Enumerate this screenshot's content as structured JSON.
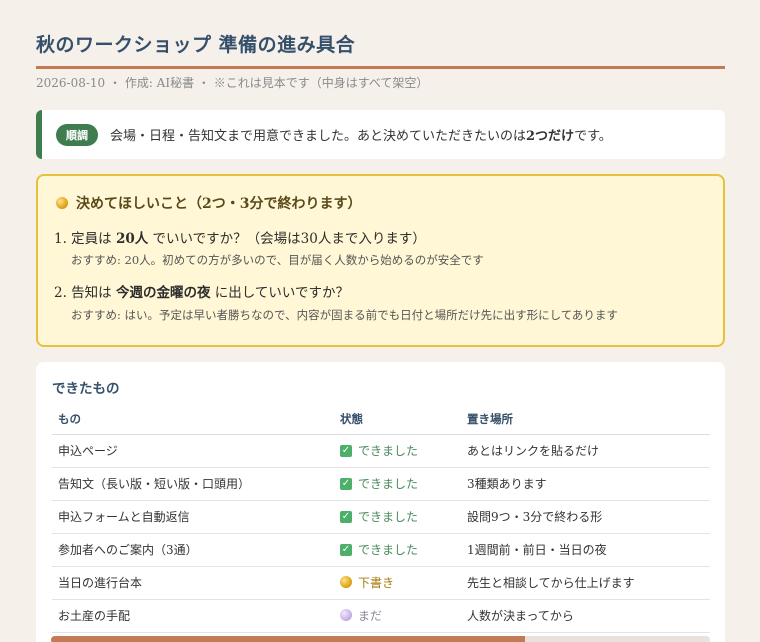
{
  "header": {
    "title": "秋のワークショップ 準備の進み具合",
    "meta": "2026-08-10 ・ 作成: AI秘書 ・ ※これは見本です（中身はすべて架空）"
  },
  "status": {
    "badge": "順調",
    "text_before": "会場・日程・告知文まで用意できました。あと決めていただきたいのは",
    "text_bold": "2つだけ",
    "text_after": "です。"
  },
  "decisions": {
    "heading": "決めてほしいこと（2つ・3分で終わります）",
    "items": [
      {
        "q_pre": "1. 定員は ",
        "q_bold": "20人",
        "q_post": " でいいですか？（会場は30人まで入ります）",
        "recommendation": "おすすめ: 20人。初めての方が多いので、目が届く人数から始めるのが安全です"
      },
      {
        "q_pre": "2. 告知は ",
        "q_bold": "今週の金曜の夜",
        "q_post": " に出していいですか？",
        "recommendation": "おすすめ: はい。予定は早い者勝ちなので、内容が固まる前でも日付と場所だけ先に出す形にしてあります"
      }
    ]
  },
  "done": {
    "title": "できたもの",
    "columns": [
      "もの",
      "状態",
      "置き場所"
    ],
    "rows": [
      {
        "item": "申込ページ",
        "state": "できました",
        "state_kind": "done",
        "place": "あとはリンクを貼るだけ"
      },
      {
        "item": "告知文（長い版・短い版・口頭用）",
        "state": "できました",
        "state_kind": "done",
        "place": "3種類あります"
      },
      {
        "item": "申込フォームと自動返信",
        "state": "できました",
        "state_kind": "done",
        "place": "設問9つ・3分で終わる形"
      },
      {
        "item": "参加者へのご案内（3通）",
        "state": "できました",
        "state_kind": "done",
        "place": "1週間前・前日・当日の夜"
      },
      {
        "item": "当日の進行台本",
        "state": "下書き",
        "state_kind": "draft",
        "place": "先生と相談してから仕上げます"
      },
      {
        "item": "お土産の手配",
        "state": "まだ",
        "state_kind": "todo",
        "place": "人数が決まってから"
      }
    ],
    "progress_fraction": 0.72
  },
  "colors": {
    "accent": "#c47a55",
    "ok": "#3f7d50",
    "title": "#35506a",
    "decide_bg": "#fff7d6",
    "decide_border": "#e8c13a"
  }
}
